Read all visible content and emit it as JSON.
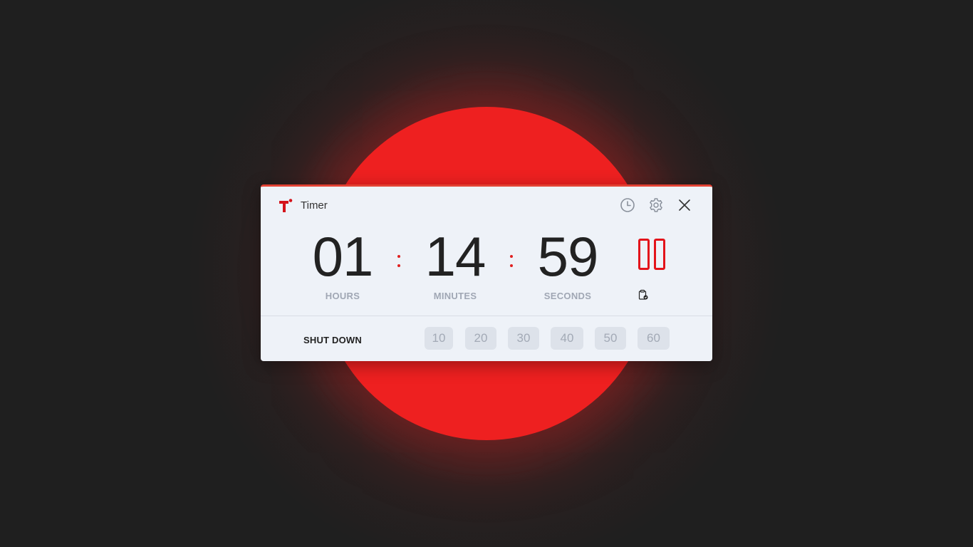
{
  "window": {
    "title": "Timer",
    "accent_color": "#e3141b"
  },
  "toolbar": {
    "history_icon": "clock-icon",
    "settings_icon": "gear-icon",
    "close_icon": "close-icon"
  },
  "timer": {
    "hours": "01",
    "minutes": "14",
    "seconds": "59",
    "hours_label": "HOURS",
    "minutes_label": "MINUTES",
    "seconds_label": "SECONDS",
    "state": "running",
    "pause_icon": "pause-icon",
    "clipboard_icon": "clipboard-icon"
  },
  "shutdown": {
    "label": "SHUT DOWN",
    "presets": [
      "10",
      "20",
      "30",
      "40",
      "50",
      "60"
    ]
  }
}
